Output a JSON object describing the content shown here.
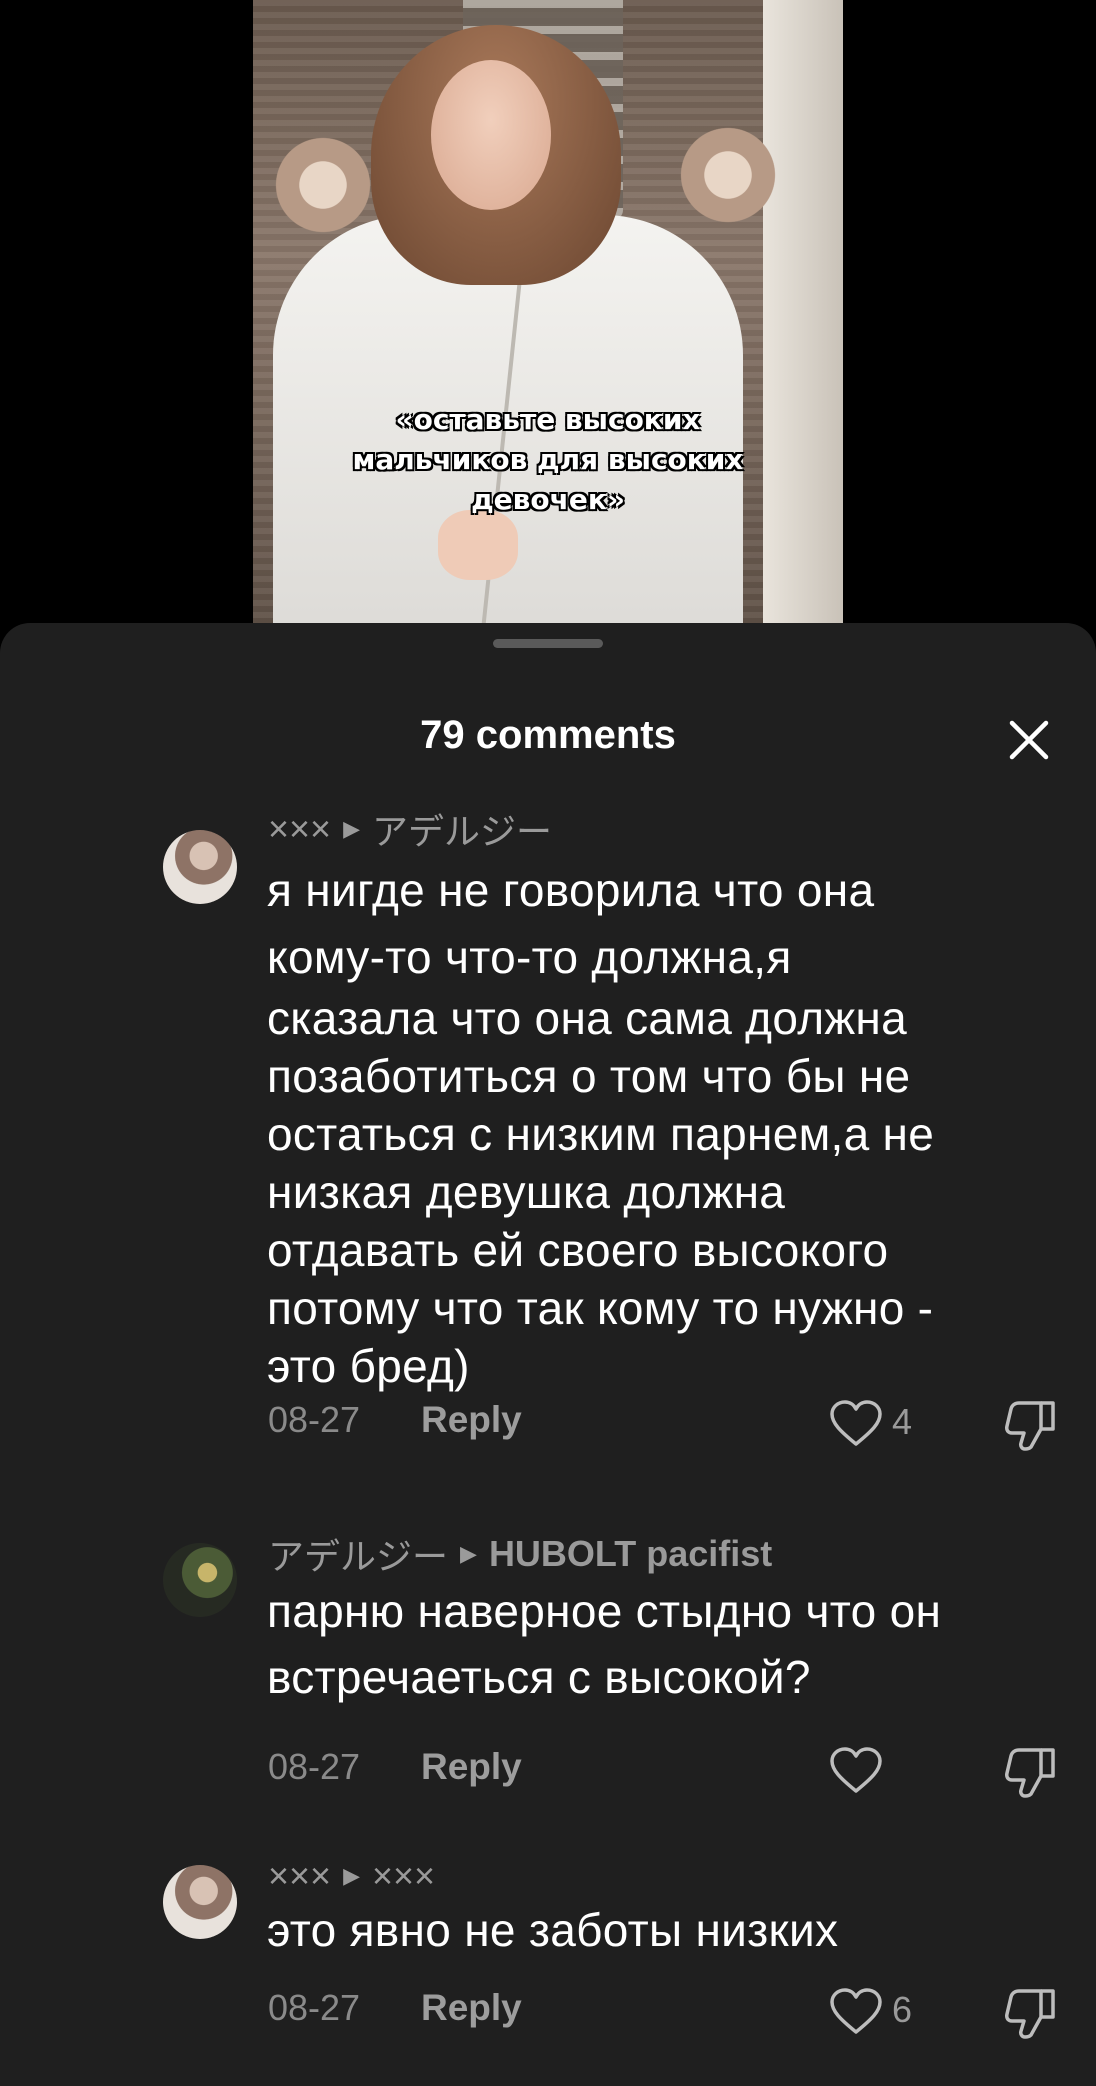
{
  "video": {
    "caption_lines": [
      "«оставьте высоких",
      "мальчиков для высоких",
      "девочек»"
    ]
  },
  "sheet": {
    "title": "79 comments"
  },
  "comments": [
    {
      "author": "×××",
      "reply_to": "アデルジー",
      "text_lines": [
        "я нигде не говорила что она",
        "кому-то что-то должна,я",
        "сказала что она сама должна",
        "позаботиться о том что бы не",
        "остаться с низким парнем,а не",
        "низкая девушка должна",
        "отдавать ей своего высокого",
        "потому что так кому то нужно -",
        "это бред)"
      ],
      "date": "08-27",
      "reply_label": "Reply",
      "likes": "4"
    },
    {
      "author": "アデルジー",
      "reply_to": "HUBOLT pacifist",
      "text_lines": [
        "парню наверное стыдно что он",
        "встречаеться с высокой?"
      ],
      "date": "08-27",
      "reply_label": "Reply",
      "likes": ""
    },
    {
      "author": "×××",
      "reply_to": "×××",
      "text_lines": [
        "это явно не заботы низких"
      ],
      "date": "08-27",
      "reply_label": "Reply",
      "likes": "6"
    }
  ],
  "icons": {
    "close": "close-icon",
    "like": "heart-outline-icon",
    "dislike": "thumbs-down-icon",
    "reply_arrow": "triangle-right-icon"
  }
}
